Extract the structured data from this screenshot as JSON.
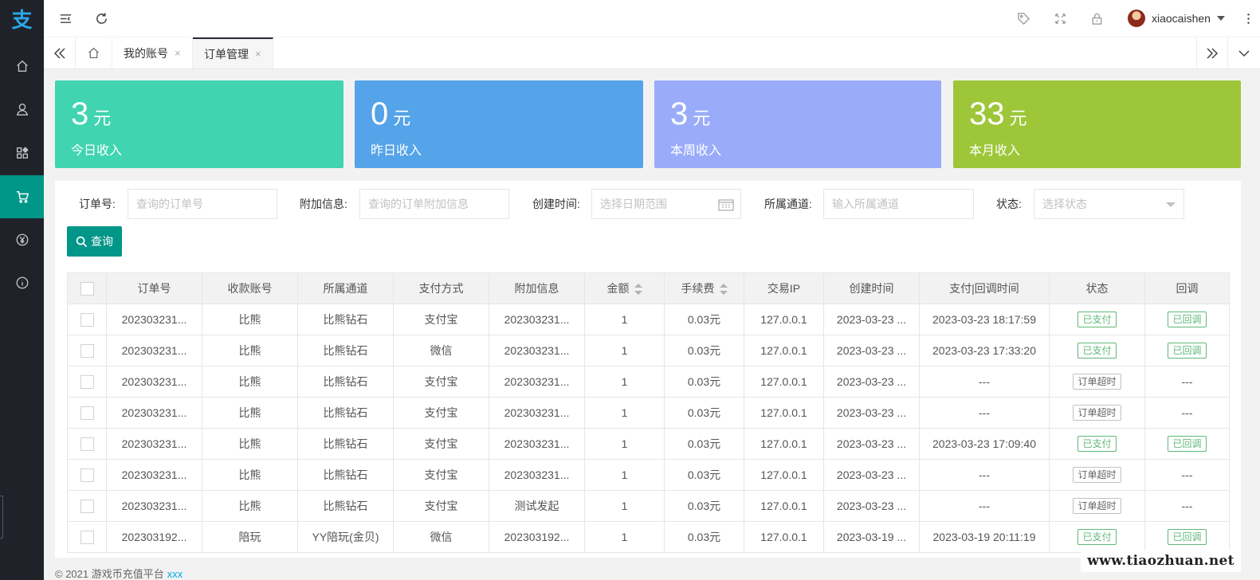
{
  "app": {
    "logo": "支"
  },
  "sidebar": {
    "items": [
      {
        "icon": "home-icon"
      },
      {
        "icon": "user-icon"
      },
      {
        "icon": "apps-icon"
      },
      {
        "icon": "cart-icon"
      },
      {
        "icon": "yen-icon"
      },
      {
        "icon": "info-icon"
      }
    ],
    "active_index": 3
  },
  "header": {
    "username": "xiaocaishen",
    "icons": [
      "menu-fold-icon",
      "refresh-icon",
      "tag-icon",
      "fullscreen-icon",
      "lock-icon",
      "more-vertical-icon"
    ]
  },
  "tabs": {
    "items": [
      {
        "label": "我的账号",
        "active": false
      },
      {
        "label": "订单管理",
        "active": true
      }
    ],
    "close_glyph": "×"
  },
  "stats": [
    {
      "value": "3",
      "unit": "元",
      "label": "今日收入",
      "color": "#40d4b0"
    },
    {
      "value": "0",
      "unit": "元",
      "label": "昨日收入",
      "color": "#55a3e8"
    },
    {
      "value": "3",
      "unit": "元",
      "label": "本周收入",
      "color": "#9aacf9"
    },
    {
      "value": "33",
      "unit": "元",
      "label": "本月收入",
      "color": "#9dc739"
    }
  ],
  "filters": {
    "order_no": {
      "label": "订单号:",
      "placeholder": "查询的订单号"
    },
    "extra": {
      "label": "附加信息:",
      "placeholder": "查询的订单附加信息"
    },
    "created": {
      "label": "创建时间:",
      "placeholder": "选择日期范围"
    },
    "channel": {
      "label": "所属通道:",
      "placeholder": "输入所属通道"
    },
    "status": {
      "label": "状态:",
      "placeholder": "选择状态"
    },
    "query_button": "查询"
  },
  "table": {
    "columns": [
      "订单号",
      "收款账号",
      "所属通道",
      "支付方式",
      "附加信息",
      "金额",
      "手续费",
      "交易IP",
      "创建时间",
      "支付|回调时间",
      "状态",
      "回调"
    ],
    "rows": [
      {
        "order": "202303231...",
        "account": "比熊",
        "channel": "比熊钻石",
        "pay": "支付宝",
        "extra": "202303231...",
        "amount": "1",
        "fee": "0.03元",
        "ip": "127.0.0.1",
        "created": "2023-03-23 ...",
        "paytime": "2023-03-23 18:17:59",
        "status": "已支付",
        "status_type": "green",
        "callback": "已回调",
        "callback_type": "green"
      },
      {
        "order": "202303231...",
        "account": "比熊",
        "channel": "比熊钻石",
        "pay": "微信",
        "extra": "202303231...",
        "amount": "1",
        "fee": "0.03元",
        "ip": "127.0.0.1",
        "created": "2023-03-23 ...",
        "paytime": "2023-03-23 17:33:20",
        "status": "已支付",
        "status_type": "green",
        "callback": "已回调",
        "callback_type": "green"
      },
      {
        "order": "202303231...",
        "account": "比熊",
        "channel": "比熊钻石",
        "pay": "支付宝",
        "extra": "202303231...",
        "amount": "1",
        "fee": "0.03元",
        "ip": "127.0.0.1",
        "created": "2023-03-23 ...",
        "paytime": "---",
        "status": "订单超时",
        "status_type": "gray",
        "callback": "---",
        "callback_type": "text"
      },
      {
        "order": "202303231...",
        "account": "比熊",
        "channel": "比熊钻石",
        "pay": "支付宝",
        "extra": "202303231...",
        "amount": "1",
        "fee": "0.03元",
        "ip": "127.0.0.1",
        "created": "2023-03-23 ...",
        "paytime": "---",
        "status": "订单超时",
        "status_type": "gray",
        "callback": "---",
        "callback_type": "text"
      },
      {
        "order": "202303231...",
        "account": "比熊",
        "channel": "比熊钻石",
        "pay": "支付宝",
        "extra": "202303231...",
        "amount": "1",
        "fee": "0.03元",
        "ip": "127.0.0.1",
        "created": "2023-03-23 ...",
        "paytime": "2023-03-23 17:09:40",
        "status": "已支付",
        "status_type": "green",
        "callback": "已回调",
        "callback_type": "green"
      },
      {
        "order": "202303231...",
        "account": "比熊",
        "channel": "比熊钻石",
        "pay": "支付宝",
        "extra": "202303231...",
        "amount": "1",
        "fee": "0.03元",
        "ip": "127.0.0.1",
        "created": "2023-03-23 ...",
        "paytime": "---",
        "status": "订单超时",
        "status_type": "gray",
        "callback": "---",
        "callback_type": "text"
      },
      {
        "order": "202303231...",
        "account": "比熊",
        "channel": "比熊钻石",
        "pay": "支付宝",
        "extra": "测试发起",
        "amount": "1",
        "fee": "0.03元",
        "ip": "127.0.0.1",
        "created": "2023-03-23 ...",
        "paytime": "---",
        "status": "订单超时",
        "status_type": "gray",
        "callback": "---",
        "callback_type": "text"
      },
      {
        "order": "202303192...",
        "account": "陪玩",
        "channel": "YY陪玩(金贝)",
        "pay": "微信",
        "extra": "202303192...",
        "amount": "1",
        "fee": "0.03元",
        "ip": "127.0.0.1",
        "created": "2023-03-19 ...",
        "paytime": "2023-03-19 20:11:19",
        "status": "已支付",
        "status_type": "green",
        "callback": "已回调",
        "callback_type": "green"
      }
    ]
  },
  "footer": {
    "text": "© 2021 游戏币充值平台",
    "link": "xxx"
  },
  "watermark": "www.tiaozhuan.net"
}
